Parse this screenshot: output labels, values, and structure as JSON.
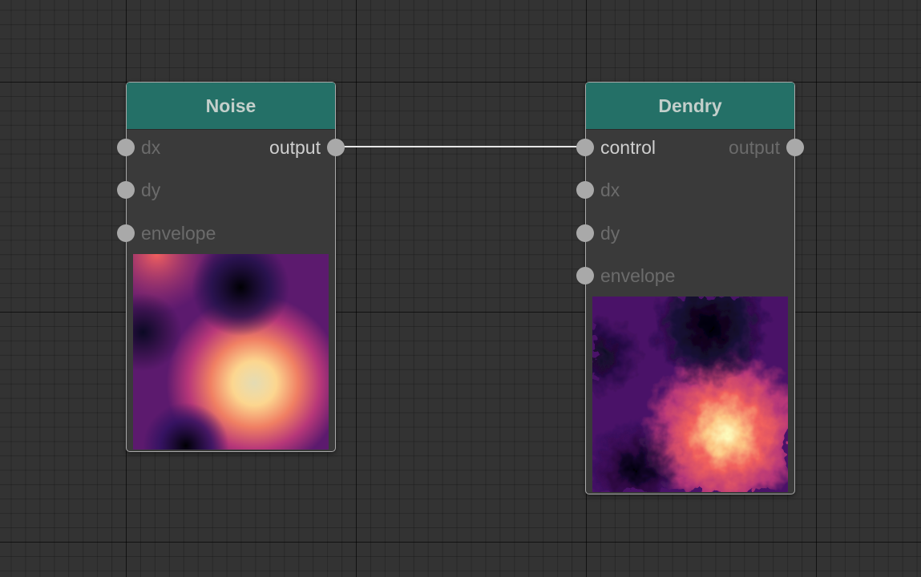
{
  "colors": {
    "background": "#333333",
    "node_header": "#247067",
    "node_body": "#3a3a3a",
    "node_border": "#a9a9a9",
    "socket": "#a9a9a9",
    "link": "#e6e6e6",
    "label_connected": "#cfcfcf",
    "label_disconnected": "#6b6b6b"
  },
  "colormap": "magma",
  "nodes": {
    "noise": {
      "title": "Noise",
      "inputs": [
        {
          "label": "dx",
          "connected": false
        },
        {
          "label": "dy",
          "connected": false
        },
        {
          "label": "envelope",
          "connected": false
        }
      ],
      "outputs": [
        {
          "label": "output",
          "connected": true
        }
      ],
      "preview": "heightmap preview"
    },
    "dendry": {
      "title": "Dendry",
      "inputs": [
        {
          "label": "control",
          "connected": true
        },
        {
          "label": "dx",
          "connected": false
        },
        {
          "label": "dy",
          "connected": false
        },
        {
          "label": "envelope",
          "connected": false
        }
      ],
      "outputs": [
        {
          "label": "output",
          "connected": false
        }
      ],
      "preview": "heightmap preview"
    }
  },
  "links": [
    {
      "from_node": "Noise",
      "from_socket": "output",
      "to_node": "Dendry",
      "to_socket": "control"
    }
  ]
}
